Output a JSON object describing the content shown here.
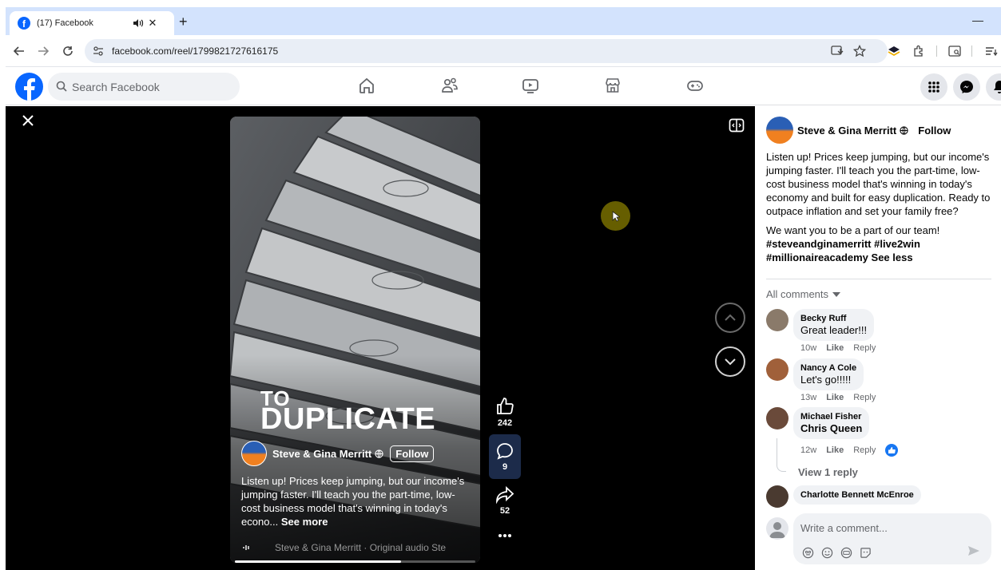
{
  "browser": {
    "tab_title": "(17) Facebook",
    "url": "facebook.com/reel/1799821727616175",
    "newtab_label": "+",
    "minimize_label": "—",
    "tab_close_label": "✕"
  },
  "fb": {
    "logo_letter": "f",
    "search_placeholder": "Search Facebook"
  },
  "reel": {
    "overlay_line1": "TO",
    "overlay_line2": "DUPLICATE",
    "author": "Steve & Gina Merritt",
    "follow_label": "Follow",
    "caption": "Listen up! Prices keep jumping, but our income's jumping faster. I'll teach you the part-time, low-cost business model that's winning in today's econo...",
    "see_more": "See more",
    "audio": "Steve & Gina Merritt · Original audio     Ste",
    "likes": "242",
    "comments": "9",
    "shares": "52",
    "progress": 0.69
  },
  "panel": {
    "author": "Steve & Gina Merritt",
    "follow_label": "Follow",
    "description": "Listen up! Prices keep jumping, but our income's jumping faster. I'll teach you the part-time, low-cost business model that's winning in today's economy and built for easy duplication. Ready to outpace inflation and set your family free?",
    "description2": "We want you to be a part of our team!",
    "hashtags": "#steveandginamerritt #live2win #millionaireacademy",
    "see_less": "See less",
    "all_comments": "All comments",
    "comments": [
      {
        "author": "Becky Ruff",
        "text": "Great leader!!!",
        "time": "10w",
        "like": "Like",
        "reply": "Reply",
        "avatar_color": "#8a7a6a"
      },
      {
        "author": "Nancy A Cole",
        "text": "Let's go!!!!!",
        "time": "13w",
        "like": "Like",
        "reply": "Reply",
        "avatar_color": "#a0603a"
      },
      {
        "author": "Michael Fisher",
        "text": "Chris Queen",
        "time": "12w",
        "like": "Like",
        "reply": "Reply",
        "avatar_color": "#6a4a3a"
      },
      {
        "author": "Charlotte Bennett McEnroe",
        "text": "",
        "time": "",
        "like": "",
        "reply": "",
        "avatar_color": "#4a3a30"
      }
    ],
    "view_replies": "View 1 reply",
    "compose_placeholder": "Write a comment..."
  },
  "colors": {
    "facebook_blue": "#0866ff",
    "like_blue": "#1877f2",
    "cursor_highlight": "#786e00"
  }
}
